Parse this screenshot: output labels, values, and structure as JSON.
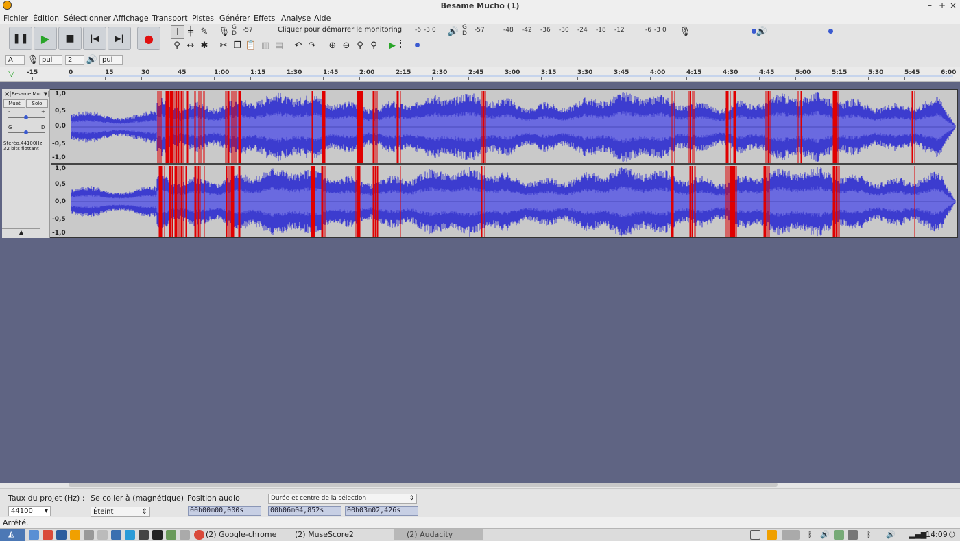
{
  "window": {
    "title": "Besame Mucho (1)",
    "controls": [
      "–",
      "+",
      "×"
    ]
  },
  "menu": [
    "Fichier",
    "Édition",
    "Sélectionner",
    "Affichage",
    "Transport",
    "Pistes",
    "Générer",
    "Effets",
    "Analyse",
    "Aide"
  ],
  "meters": {
    "record_scale": [
      "-57",
      "Cliquer pour démarrer le monitoring",
      "-6",
      "-3",
      "0"
    ],
    "play_scale": [
      "-57",
      "-48",
      "-42",
      "-36",
      "-30",
      "-24",
      "-18",
      "-12",
      "-6",
      "-3",
      "0"
    ],
    "gd": "G D"
  },
  "device_toolbar": {
    "host": "A",
    "rec_device": "pul",
    "channels": "2",
    "play_device": "pul"
  },
  "ruler": {
    "ticks": [
      "-15",
      "0",
      "15",
      "30",
      "45",
      "1:00",
      "1:15",
      "1:30",
      "1:45",
      "2:00",
      "2:15",
      "2:30",
      "2:45",
      "3:00",
      "3:15",
      "3:30",
      "3:45",
      "4:00",
      "4:15",
      "4:30",
      "4:45",
      "5:00",
      "5:15",
      "5:30",
      "5:45",
      "6:00"
    ]
  },
  "track": {
    "name": "Besame Muc",
    "mute": "Muet",
    "solo": "Solo",
    "gain_minus": "-",
    "gain_plus": "+",
    "pan_left": "G",
    "pan_right": "D",
    "info_1": "Stéréo,44100Hz",
    "info_2": "32 bits flottant",
    "scale_top": [
      "1,0",
      "0,5",
      "0,0",
      "-0,5",
      "-1,0"
    ],
    "scale_bottom": [
      "1,0",
      "0,5",
      "0,0",
      "-0,5",
      "-1,0"
    ]
  },
  "selection_bar": {
    "rate_label": "Taux du projet (Hz) :",
    "rate_value": "44100",
    "snap_label": "Se coller à (magnétique)",
    "snap_value": "Éteint",
    "position_label": "Position audio",
    "position_value": "00h00m00,000s",
    "selection_mode": "Durée et centre de la sélection",
    "sel_duration": "00h06m04,852s",
    "sel_center": "00h03m02,426s"
  },
  "status": "Arrêté.",
  "taskbar": {
    "apps": [
      "(2) Google-chrome",
      "(2) MuseScore2",
      "(2) Audacity"
    ],
    "clock": "14:09"
  },
  "colors": {
    "waveform": "#3c3ccf",
    "waveform_rms": "#6a6ae0",
    "clipping": "#e00000",
    "workspace": "#5f6483"
  }
}
